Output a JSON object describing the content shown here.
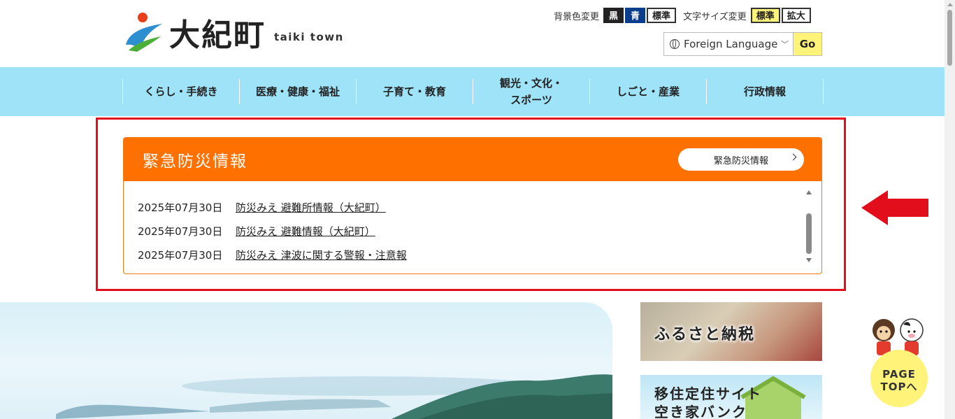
{
  "header": {
    "logo_title": "大紀町",
    "logo_subtitle": "taiki town",
    "bg_color_label": "背景色変更",
    "bg_buttons": [
      "黒",
      "青",
      "標準"
    ],
    "font_size_label": "文字サイズ変更",
    "font_buttons": [
      "標準",
      "拡大"
    ],
    "language_select": "Foreign Language",
    "go_button": "Go"
  },
  "nav": {
    "items": [
      "くらし・手続き",
      "医療・健康・福祉",
      "子育て・教育",
      "観光・文化・\nスポーツ",
      "しごと・産業",
      "行政情報"
    ]
  },
  "emergency": {
    "title": "緊急防災情報",
    "link_label": "緊急防災情報",
    "items": [
      {
        "date": "2025年07月30日",
        "title": "防災みえ 避難所情報（大紀町）"
      },
      {
        "date": "2025年07月30日",
        "title": "防災みえ 避難情報（大紀町）"
      },
      {
        "date": "2025年07月30日",
        "title": "防災みえ 津波に関する警報・注意報"
      }
    ]
  },
  "banners": {
    "furusato": "ふるさと納税",
    "iju_line1": "移住定住サイト",
    "iju_line2": "空き家バンク"
  },
  "page_top": {
    "line1": "PAGE",
    "line2": "TOPへ"
  },
  "colors": {
    "nav_bg": "#9ee3f8",
    "emergency_orange": "#fe7000",
    "highlight_red": "#e30e1c",
    "accent_yellow": "#fff37a"
  }
}
